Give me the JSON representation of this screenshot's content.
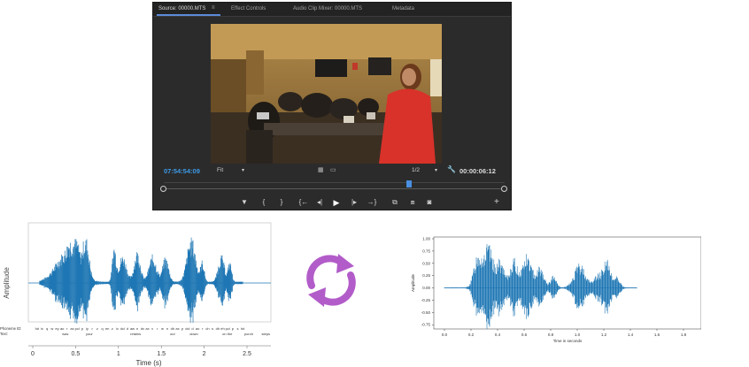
{
  "monitor": {
    "tabs": [
      {
        "label": "Source: 00000.MTS"
      },
      {
        "label": "Effect Controls"
      },
      {
        "label": "Audio Clip Mixer: 00000.MTS"
      },
      {
        "label": "Metadata"
      }
    ],
    "tab_menu": "≡",
    "timecode_left": "07:54:54:09",
    "fit": "Fit",
    "fit_caret": "▾",
    "ratio": "1/2",
    "ratio_caret": "▾",
    "wrench": "🔧",
    "timecode_right": "00:00:06:12",
    "playhead_fraction": 0.72,
    "controls": [
      {
        "glyph": "▼",
        "name": "add-marker-icon"
      },
      {
        "glyph": "{",
        "name": "mark-in-icon"
      },
      {
        "glyph": "}",
        "name": "mark-out-icon"
      },
      {
        "glyph": "{←",
        "name": "go-to-in-icon"
      },
      {
        "glyph": "◂|",
        "name": "step-back-icon"
      },
      {
        "glyph": "▶",
        "name": "play-icon"
      },
      {
        "glyph": "|▸",
        "name": "step-forward-icon"
      },
      {
        "glyph": "→}",
        "name": "go-to-out-icon"
      },
      {
        "glyph": "⧉",
        "name": "insert-icon"
      },
      {
        "glyph": "⧈",
        "name": "overwrite-icon"
      },
      {
        "glyph": "◙",
        "name": "export-frame-icon"
      }
    ],
    "plus": "+"
  },
  "left_chart": {
    "ylabel": "Amplitude",
    "xlabel": "Time (s)",
    "xticks": [
      "0",
      "0.5",
      "1",
      "1.5",
      "2",
      "2.5"
    ],
    "phoneme_label": "Phoneme ID:",
    "text_label": "Text:",
    "phonemes": [
      "h#",
      "ix",
      "q",
      "w",
      "ey",
      "ao",
      "r",
      "ax",
      "pcl",
      "p",
      "iy",
      "r",
      "z",
      "q",
      "en",
      "z",
      "ix",
      "dcl",
      "d",
      "aw",
      "n",
      "dx",
      "ax",
      "v",
      "r",
      "w",
      "n",
      "dh",
      "ax",
      "p",
      "dcl",
      "d",
      "ao",
      "r",
      "ch",
      "s",
      "dh",
      "eh",
      "pcl",
      "p",
      "s",
      "h#"
    ],
    "words": [
      {
        "t": "was",
        "x": 0.38
      },
      {
        "t": "your",
        "x": 0.66
      },
      {
        "t": "retains",
        "x": 1.2
      },
      {
        "t": "out",
        "x": 1.63
      },
      {
        "t": "down",
        "x": 1.88
      },
      {
        "t": "on the",
        "x": 2.27
      },
      {
        "t": "porch",
        "x": 2.52
      },
      {
        "t": "steps",
        "x": 2.72
      }
    ],
    "color": "#1f77b4"
  },
  "right_chart": {
    "ylabel": "Amplitude",
    "xlabel": "Time in seconds",
    "yticks": [
      "1.00",
      "0.75",
      "0.50",
      "0.25",
      "0.00",
      "-0.25",
      "-0.50",
      "-0.75"
    ],
    "xticks": [
      "0.0",
      "0.2",
      "0.4",
      "0.6",
      "0.8",
      "1.0",
      "1.2",
      "1.4",
      "1.6",
      "1.8"
    ],
    "color": "#1f77b4"
  },
  "sync_color": "#b25cc9"
}
